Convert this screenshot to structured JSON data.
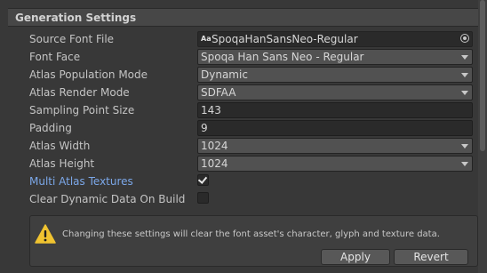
{
  "section": {
    "title": "Generation Settings"
  },
  "fields": {
    "source_font_file": {
      "label": "Source Font File",
      "value": "SpoqaHanSansNeo-Regular",
      "icon": "font-asset-icon",
      "icon_text": "Aa"
    },
    "font_face": {
      "label": "Font Face",
      "value": "Spoqa Han Sans Neo - Regular"
    },
    "atlas_population_mode": {
      "label": "Atlas Population Mode",
      "value": "Dynamic"
    },
    "atlas_render_mode": {
      "label": "Atlas Render Mode",
      "value": "SDFAA"
    },
    "sampling_point_size": {
      "label": "Sampling Point Size",
      "value": "143"
    },
    "padding": {
      "label": "Padding",
      "value": "9"
    },
    "atlas_width": {
      "label": "Atlas Width",
      "value": "1024"
    },
    "atlas_height": {
      "label": "Atlas Height",
      "value": "1024"
    },
    "multi_atlas_textures": {
      "label": "Multi Atlas Textures",
      "checked": true
    },
    "clear_dynamic_data": {
      "label": "Clear Dynamic Data On Build",
      "checked": false
    }
  },
  "warning": {
    "text": "Changing these settings will clear the font asset's character, glyph and texture data.",
    "apply_label": "Apply",
    "revert_label": "Revert"
  },
  "colors": {
    "background": "#383838",
    "active_label": "#7ba7e8",
    "warning_yellow": "#f0c330"
  }
}
